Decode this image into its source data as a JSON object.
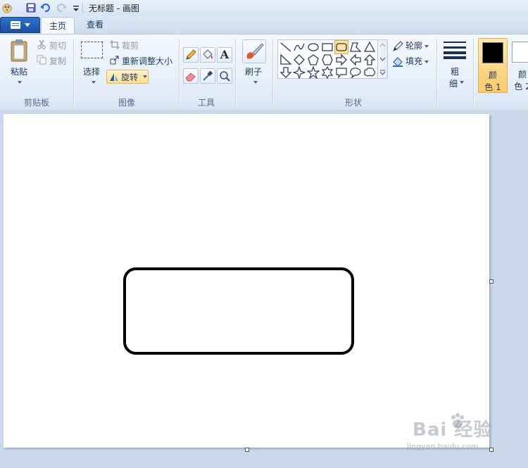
{
  "window": {
    "title": "无标题 - 画图"
  },
  "tabs": [
    {
      "label": "主页"
    },
    {
      "label": "查看"
    }
  ],
  "clipboard": {
    "paste": "粘贴",
    "cut": "剪切",
    "copy": "复制",
    "group": "剪贴板"
  },
  "image": {
    "select": "选择",
    "crop": "裁剪",
    "resize": "重新调整大小",
    "rotate": "旋转",
    "group": "图像"
  },
  "tools": {
    "group": "工具",
    "text_tool": "A"
  },
  "brushes": {
    "label": "刷子"
  },
  "shapes": {
    "outline": "轮廓",
    "fill": "填充",
    "group": "形状"
  },
  "size": {
    "label_line1": "粗",
    "label_line2": "细"
  },
  "colors": {
    "color1_line1": "颜",
    "color1_line2": "色 1",
    "color2_line1": "颜",
    "color2_line2": "色 2",
    "color1_value": "#000000",
    "color2_value": "#ffffff",
    "accent": "#2e72c8"
  },
  "watermark": {
    "text": "Bai 经验",
    "url": "jingyan.baidu.com"
  }
}
